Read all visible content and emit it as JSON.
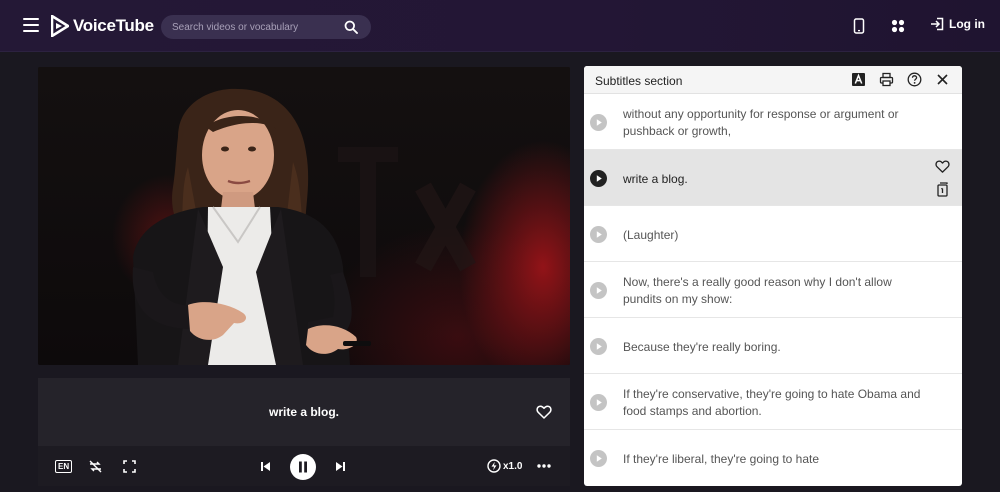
{
  "header": {
    "brand": "VoiceTube",
    "search_placeholder": "Search videos or vocabulary",
    "login_label": "Log in"
  },
  "player": {
    "current_subtitle": "write a blog.",
    "language_badge": "EN",
    "speed_label": "x1.0"
  },
  "panel": {
    "title": "Subtitles section",
    "rows": [
      {
        "text": "without any opportunity for response or argument or pushback or growth,",
        "active": false
      },
      {
        "text": "write a blog.",
        "active": true
      },
      {
        "text": "(Laughter)",
        "active": false
      },
      {
        "text": "Now, there's a really good reason why I don't allow pundits on my show:",
        "active": false
      },
      {
        "text": "Because they're really boring.",
        "active": false
      },
      {
        "text": "If they're conservative, they're going to hate Obama and food stamps and abortion.",
        "active": false
      },
      {
        "text": "If they're liberal, they're going to hate",
        "active": false
      }
    ]
  },
  "colors": {
    "header_bg": "#241836",
    "page_bg": "#1a1820",
    "active_row_bg": "#e4e4e4",
    "stage_red": "#a01419"
  }
}
